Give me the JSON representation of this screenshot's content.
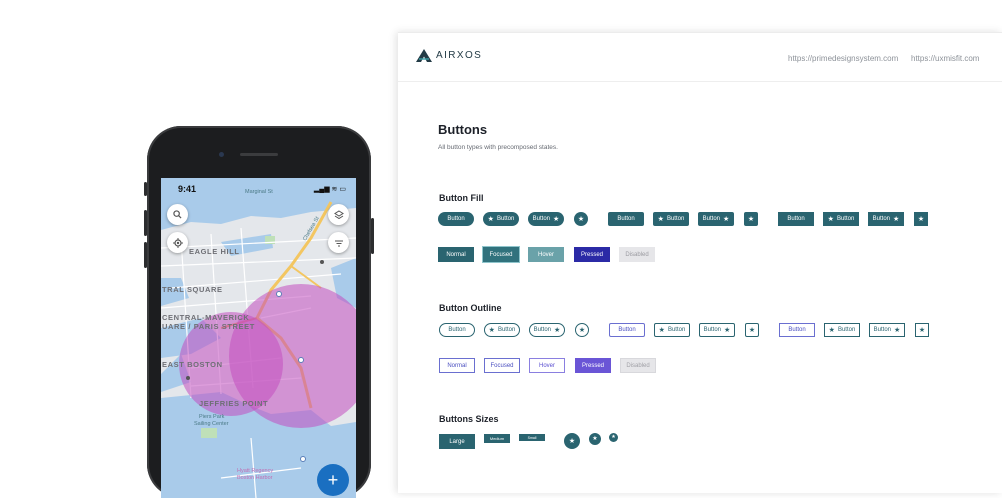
{
  "colors": {
    "primary": "#2a6470",
    "pressed": "#2b2aa6",
    "outline_pressed": "#6a55d6",
    "map_circle": "#c34fc0",
    "fab": "#1a6fc1"
  },
  "phone": {
    "time": "9:41",
    "status_icons": "▂▄▆ ≋ ▭",
    "map_labels": {
      "eagle_hill": "EAGLE HILL",
      "central_square": "TRAL SQUARE",
      "maverick_1": "CENTRAL-MAVERICK",
      "maverick_2": "UARE / PARIS STREET",
      "east_boston": "EAST BOSTON",
      "jeffries": "JEFFRIES POINT",
      "piers_1": "Piers Park",
      "piers_2": "Sailing Center",
      "marginal": "Marginal St",
      "chelsea": "Chelsea St",
      "hotel_1": "Hyatt Regency",
      "hotel_2": "Boston Harbor"
    },
    "buttons": {
      "search_icon": "search-icon",
      "locate_icon": "crosshair-icon",
      "layers_icon": "layers-icon",
      "filter_icon": "filter-icon",
      "fab_label": "+"
    }
  },
  "panel": {
    "logo_text": "AIRXOS",
    "links": [
      "https://primedesignsystem.com",
      "https://uxmisfit.com"
    ],
    "title": "Buttons",
    "subtitle": "All button types with precomposed states.",
    "sections": {
      "fill": "Button Fill",
      "outline": "Button Outline",
      "sizes": "Buttons Sizes"
    },
    "button_label": "Button",
    "star": "★",
    "states": [
      "Normal",
      "Focused",
      "Hover",
      "Pressed",
      "Disabled"
    ],
    "sizes": [
      "Large",
      "Medium",
      "Small"
    ]
  }
}
